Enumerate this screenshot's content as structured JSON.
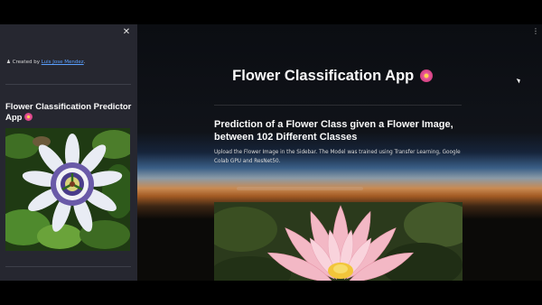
{
  "sidebar": {
    "close_icon": "close-icon",
    "created_prefix": "Created by ",
    "author_name": "Luis Jose Mendez",
    "created_suffix": ".",
    "title": "Flower Classification Predictor App",
    "title_emoji": "hibiscus-icon",
    "image_subject": "passion-flower"
  },
  "main": {
    "menu_icon": "kebab-menu-icon",
    "title": "Flower Classification App",
    "title_emoji": "hibiscus-icon",
    "heading": "Prediction of a Flower Class given a Flower Image, between 102 Different Classes",
    "description": "Upload the Flower Image in the Sidebar. The Model was trained using Transfer Learning, Google Colab GPU and ResNet50.",
    "image_subject": "lotus-flower"
  },
  "colors": {
    "sidebar_bg": "#262730",
    "main_bg": "#0e1117",
    "link": "#5aa0ff",
    "text": "#fafafa"
  }
}
